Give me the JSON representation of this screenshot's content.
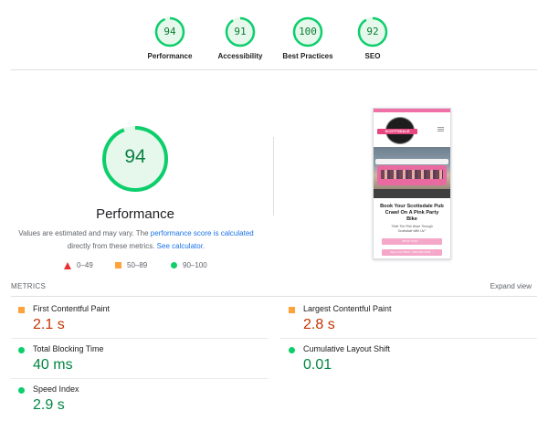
{
  "categories": [
    {
      "label": "Performance",
      "score": "94",
      "value": 94
    },
    {
      "label": "Accessibility",
      "score": "91",
      "value": 91
    },
    {
      "label": "Best Practices",
      "score": "100",
      "value": 100
    },
    {
      "label": "SEO",
      "score": "92",
      "value": 92
    }
  ],
  "main": {
    "score": "94",
    "score_value": 94,
    "title": "Performance",
    "desc_prefix": "Values are estimated and may vary. The ",
    "desc_link1": "performance score is calculated",
    "desc_mid": " directly from these metrics. ",
    "desc_link2": "See calculator."
  },
  "legend": {
    "fail": "0–49",
    "average": "50–89",
    "pass": "90–100"
  },
  "screenshot": {
    "logo_text": "SCOTTSDALE",
    "headline": "Book Your Scottsdale Pub Crawl On A Pink Party Bike",
    "subtext": "\"Ride The Pink Wave Through Scottsdale With Us!\"",
    "button1": "BOOK NOW →",
    "button2": "CALL US TODAY (480) 800-3030 →"
  },
  "metrics_section": {
    "label": "METRICS",
    "expand": "Expand view"
  },
  "metrics": [
    {
      "name": "First Contentful Paint",
      "value": "2.1 s",
      "status": "average"
    },
    {
      "name": "Largest Contentful Paint",
      "value": "2.8 s",
      "status": "average"
    },
    {
      "name": "Total Blocking Time",
      "value": "40 ms",
      "status": "pass"
    },
    {
      "name": "Cumulative Layout Shift",
      "value": "0.01",
      "status": "pass"
    },
    {
      "name": "Speed Index",
      "value": "2.9 s",
      "status": "pass"
    }
  ],
  "colors": {
    "pass": "#0cce6b",
    "pass_text": "#018642",
    "average": "#ffa23a",
    "average_text": "#c33300",
    "fail": "#eb2e2e",
    "link": "#1a73e8"
  }
}
